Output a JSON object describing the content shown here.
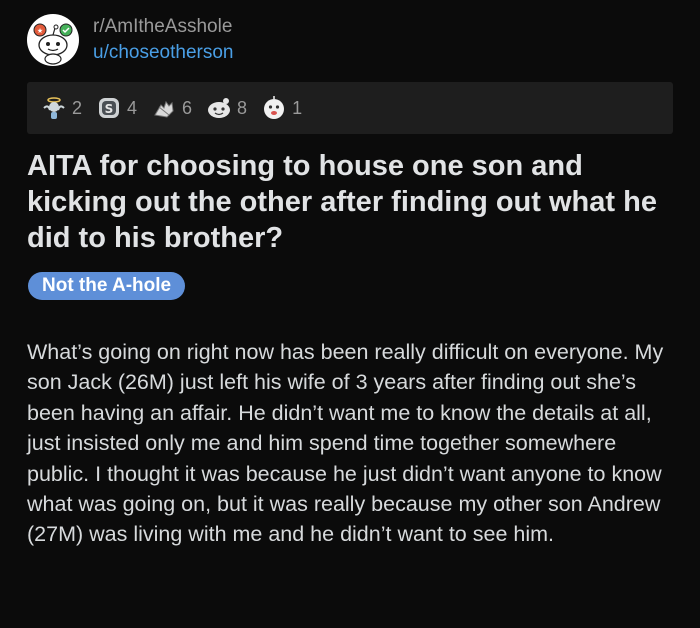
{
  "post": {
    "subreddit": "r/AmItheAsshole",
    "username": "u/choseotherson",
    "awards": [
      {
        "icon": "angel-award-icon",
        "count": "2"
      },
      {
        "icon": "silver-award-icon",
        "count": "4"
      },
      {
        "icon": "hands-award-icon",
        "count": "6"
      },
      {
        "icon": "wholesome-award-icon",
        "count": "8"
      },
      {
        "icon": "face-award-icon",
        "count": "1"
      }
    ],
    "title": "AITA for choosing to house one son and kicking out the other after finding out what he did to his brother?",
    "flair": "Not the A-hole",
    "body": "What’s going on right now has been really difficult on everyone. My son Jack (26M) just left his wife of 3 years after finding out she’s been having an affair. He didn’t want me to know the details at all, just insisted only me and him spend time together somewhere public. I thought it was because he just didn’t want anyone to know what was going on, but it was really because my other son Andrew (27M) was living with me and he didn’t want to see him."
  },
  "colors": {
    "background": "#0b0b0b",
    "awards_bar": "#1e1e1e",
    "username": "#4a9fe6",
    "flair_bg": "#5e8fd8",
    "text": "#d7dadc"
  }
}
